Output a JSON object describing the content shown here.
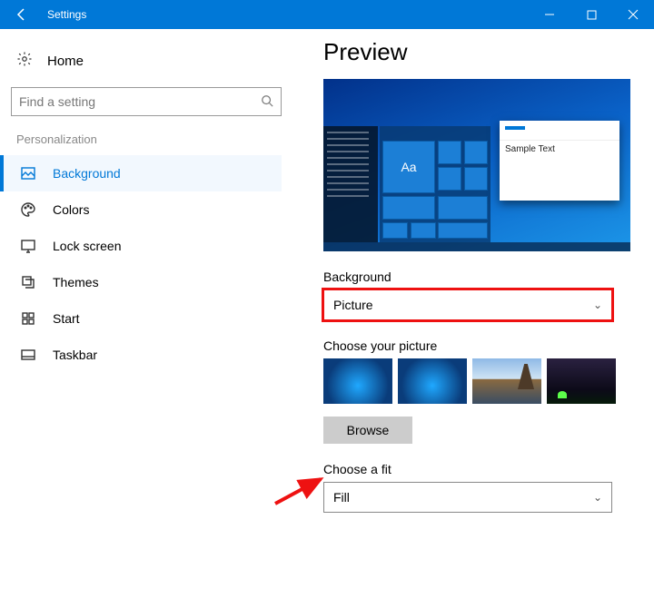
{
  "titlebar": {
    "title": "Settings"
  },
  "sidebar": {
    "home_label": "Home",
    "search_placeholder": "Find a setting",
    "section_label": "Personalization",
    "items": [
      {
        "label": "Background"
      },
      {
        "label": "Colors"
      },
      {
        "label": "Lock screen"
      },
      {
        "label": "Themes"
      },
      {
        "label": "Start"
      },
      {
        "label": "Taskbar"
      }
    ]
  },
  "main": {
    "heading": "Preview",
    "sample_window_text": "Sample Text",
    "tile_aa": "Aa",
    "background_label": "Background",
    "background_value": "Picture",
    "choose_picture_label": "Choose your picture",
    "browse_label": "Browse",
    "choose_fit_label": "Choose a fit",
    "choose_fit_value": "Fill"
  }
}
